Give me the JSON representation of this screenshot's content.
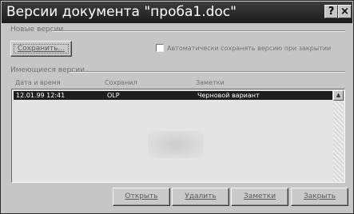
{
  "window": {
    "title": "Версии документа \"проба1.doc\"",
    "help_label": "?",
    "close_label": "×"
  },
  "new_versions": {
    "group_label": "Новые версии",
    "save_now_label": "Сохранить...",
    "auto_save_checked": false,
    "auto_save_label": "Автоматически сохранять версию при закрытии"
  },
  "existing_versions": {
    "group_label": "Имеющиеся версии",
    "columns": [
      "Дата и время",
      "Сохранил",
      "Заметки"
    ],
    "rows": [
      {
        "datetime": "12.01.99 12:41",
        "saved_by": "OLP",
        "comment": "Черновой вариант",
        "selected": true
      }
    ],
    "scroll_up_icon": "arrow-up-icon"
  },
  "buttons": {
    "open": "Открыть",
    "delete": "Удалить",
    "comment": "Заметки",
    "close": "Закрыть"
  }
}
